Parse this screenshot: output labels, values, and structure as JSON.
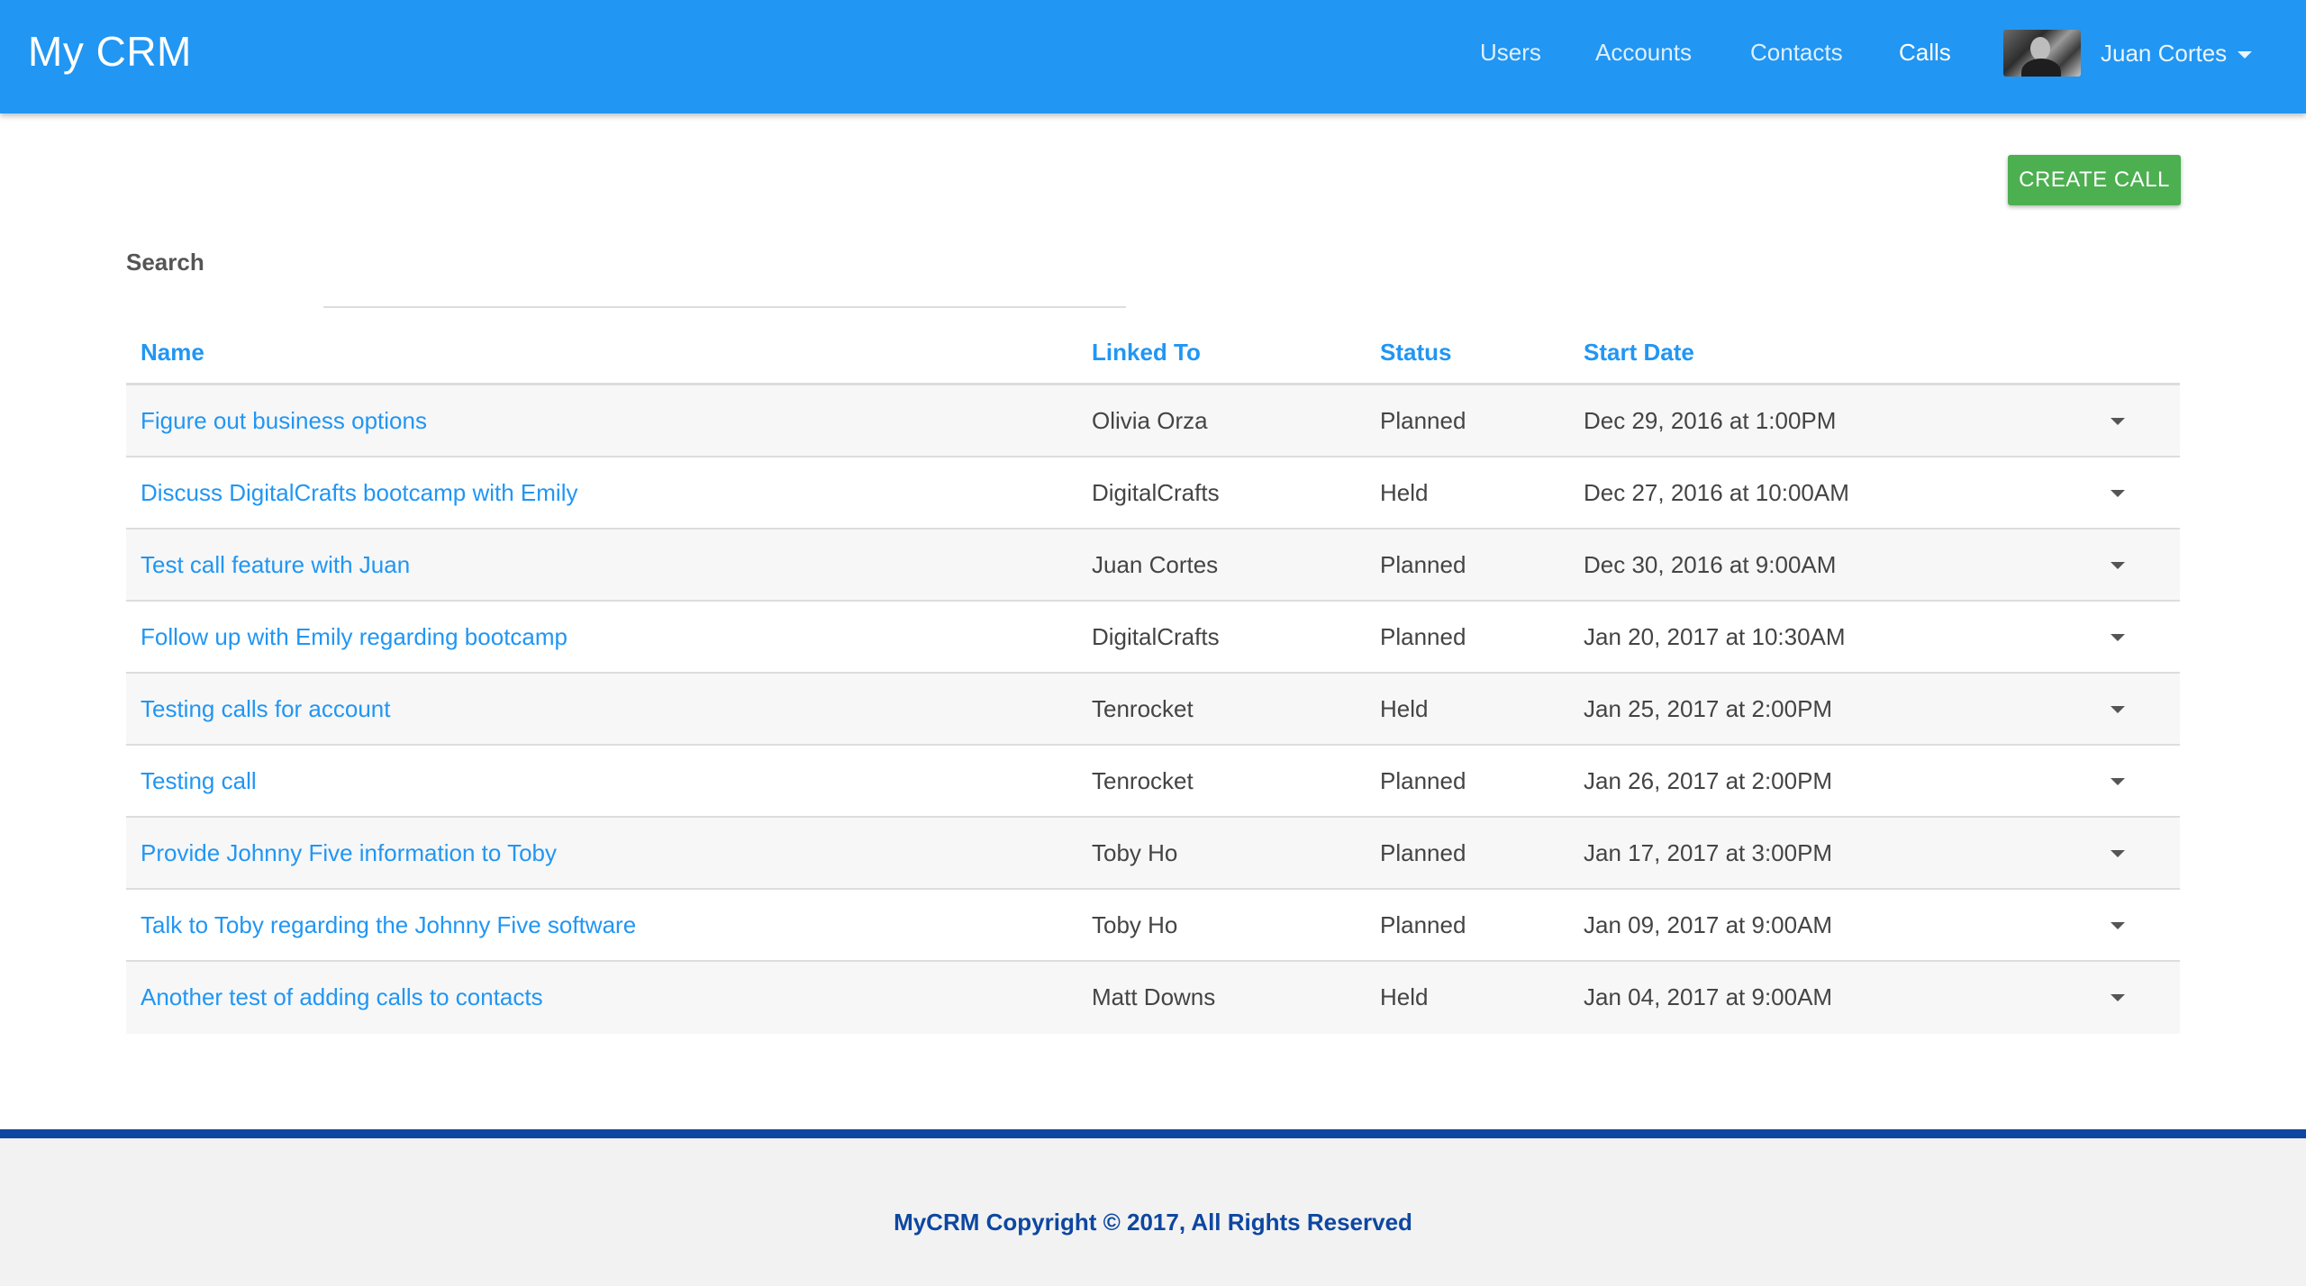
{
  "app": {
    "brand": "My CRM"
  },
  "nav": {
    "users": "Users",
    "accounts": "Accounts",
    "contacts": "Contacts",
    "calls": "Calls",
    "active": "Calls"
  },
  "user": {
    "name": "Juan Cortes"
  },
  "actions": {
    "create_label": "CREATE CALL"
  },
  "search": {
    "label": "Search",
    "value": "",
    "placeholder": ""
  },
  "table": {
    "headers": {
      "name": "Name",
      "linked_to": "Linked To",
      "status": "Status",
      "start_date": "Start Date"
    },
    "rows": [
      {
        "name": "Figure out business options",
        "linked_to": "Olivia Orza",
        "status": "Planned",
        "start_date": "Dec 29, 2016 at 1:00PM"
      },
      {
        "name": "Discuss DigitalCrafts bootcamp with Emily",
        "linked_to": "DigitalCrafts",
        "status": "Held",
        "start_date": "Dec 27, 2016 at 10:00AM"
      },
      {
        "name": "Test call feature with Juan",
        "linked_to": "Juan Cortes",
        "status": "Planned",
        "start_date": "Dec 30, 2016 at 9:00AM"
      },
      {
        "name": "Follow up with Emily regarding bootcamp",
        "linked_to": "DigitalCrafts",
        "status": "Planned",
        "start_date": "Jan 20, 2017 at 10:30AM"
      },
      {
        "name": "Testing calls for account",
        "linked_to": "Tenrocket",
        "status": "Held",
        "start_date": "Jan 25, 2017 at 2:00PM"
      },
      {
        "name": "Testing call",
        "linked_to": "Tenrocket",
        "status": "Planned",
        "start_date": "Jan 26, 2017 at 2:00PM"
      },
      {
        "name": "Provide Johnny Five information to Toby",
        "linked_to": "Toby Ho",
        "status": "Planned",
        "start_date": "Jan 17, 2017 at 3:00PM"
      },
      {
        "name": "Talk to Toby regarding the Johnny Five software",
        "linked_to": "Toby Ho",
        "status": "Planned",
        "start_date": "Jan 09, 2017 at 9:00AM"
      },
      {
        "name": "Another test of adding calls to contacts",
        "linked_to": "Matt Downs",
        "status": "Held",
        "start_date": "Jan 04, 2017 at 9:00AM"
      }
    ]
  },
  "footer": {
    "text": "MyCRM Copyright © 2017, All Rights Reserved"
  },
  "colors": {
    "primary": "#2196f3",
    "create_button": "#4caf50",
    "footer_accent": "#0d47a1",
    "row_stripe": "#f7f7f7"
  },
  "icons": {
    "user_menu": "chevron-down-icon",
    "row_menu": "chevron-down-icon"
  }
}
